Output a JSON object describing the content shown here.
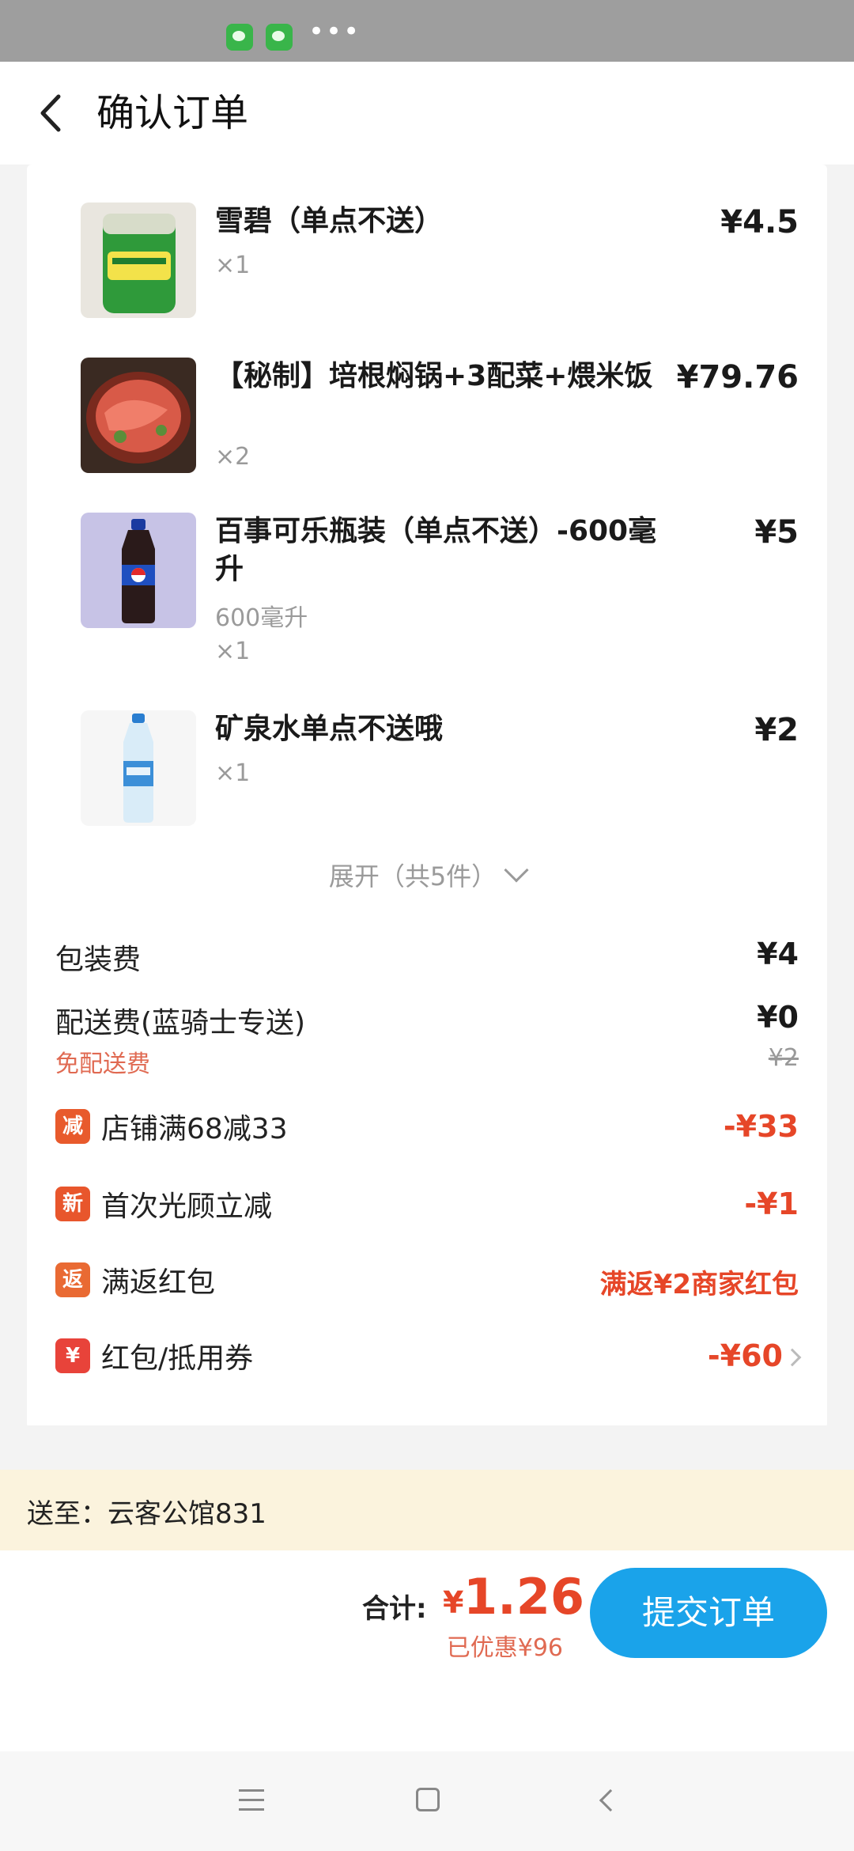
{
  "header": {
    "title": "确认订单"
  },
  "items": [
    {
      "name": "雪碧（单点不送）",
      "price": "¥4.5",
      "qty": "×1",
      "image": "sprite-can"
    },
    {
      "name": "【秘制】培根焖锅+3配菜+煨米饭",
      "price": "¥79.76",
      "qty": "×2",
      "image": "bacon-hotpot"
    },
    {
      "name": "百事可乐瓶装（单点不送）-600毫升",
      "price": "¥5",
      "spec": "600毫升",
      "qty": "×1",
      "image": "pepsi-bottle"
    },
    {
      "name": "矿泉水单点不送哦",
      "price": "¥2",
      "qty": "×1",
      "image": "water-bottle"
    }
  ],
  "expand": {
    "label": "展开（共5件）"
  },
  "fees": {
    "packaging": {
      "label": "包装费",
      "value": "¥4"
    },
    "delivery": {
      "label": "配送费(蓝骑士专送)",
      "value": "¥0",
      "note": "免配送费",
      "original": "¥2"
    }
  },
  "discounts": [
    {
      "badge": "减",
      "label": "店铺满68减33",
      "value": "-¥33"
    },
    {
      "badge": "新",
      "label": "首次光顾立减",
      "value": "-¥1"
    },
    {
      "badge": "返",
      "label": "满返红包",
      "value": "满返¥2商家红包"
    },
    {
      "badge": "¥",
      "label": "红包/抵用券",
      "value": "-¥60"
    }
  ],
  "address": {
    "text": "送至：云客公馆831"
  },
  "footer": {
    "total_label": "合计:",
    "currency": "¥",
    "total": "1.26",
    "saved": "已优惠¥96",
    "submit_label": "提交订单"
  },
  "colors": {
    "accent": "#1aa3ea",
    "price_red": "#e64628",
    "address_bg": "#fbf3dd"
  }
}
